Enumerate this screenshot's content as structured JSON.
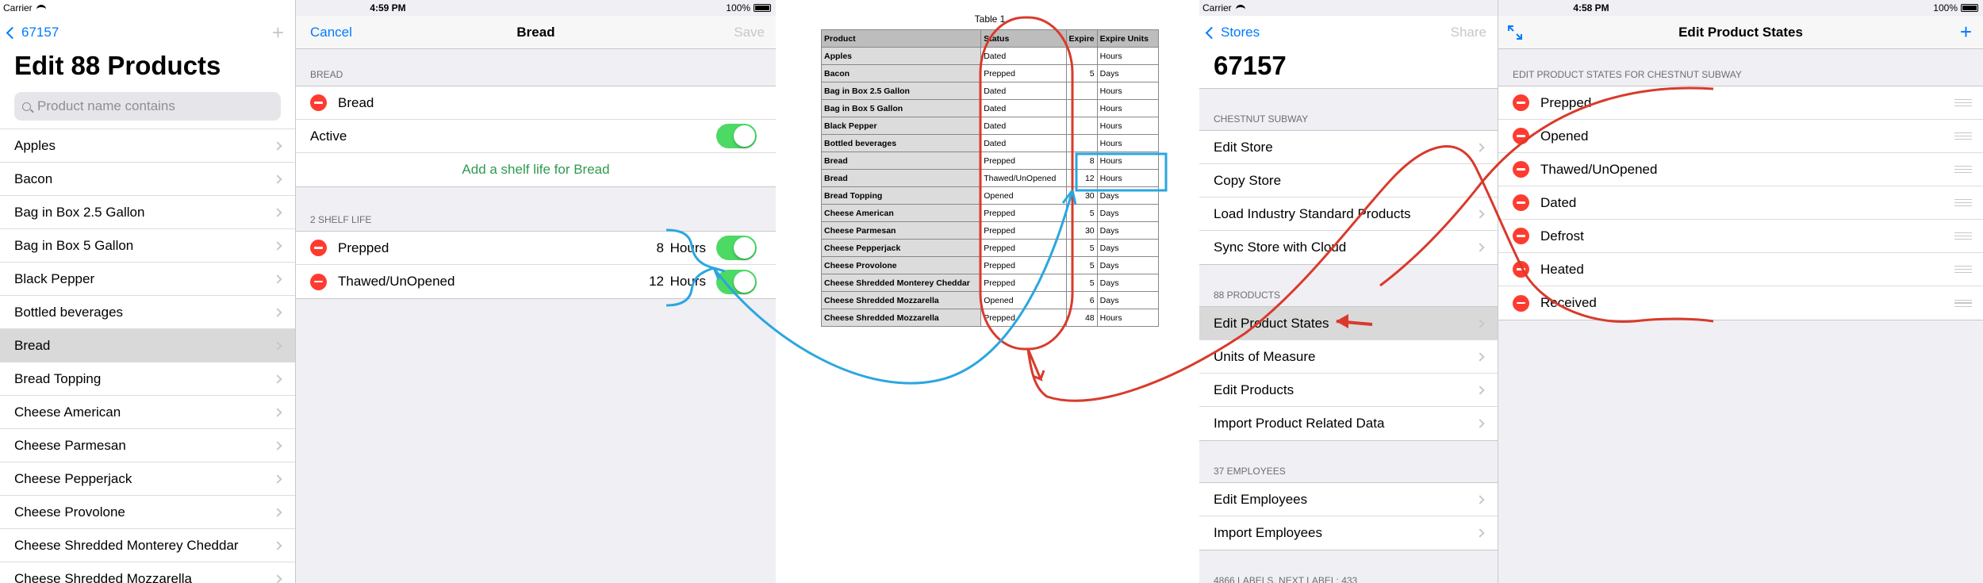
{
  "left_ipad": {
    "status": {
      "carrier": "Carrier",
      "time": "4:59 PM",
      "battery": "100%"
    },
    "master": {
      "back_label": "67157",
      "title": "Edit 88 Products",
      "search_placeholder": "Product name contains",
      "products": [
        "Apples",
        "Bacon",
        "Bag in Box 2.5 Gallon",
        "Bag in Box 5 Gallon",
        "Black Pepper",
        "Bottled beverages",
        "Bread",
        "Bread Topping",
        "Cheese American",
        "Cheese Parmesan",
        "Cheese Pepperjack",
        "Cheese Provolone",
        "Cheese Shredded Monterey Cheddar",
        "Cheese Shredded Mozzarella"
      ],
      "selected_index": 6
    },
    "detail": {
      "cancel_label": "Cancel",
      "title": "Bread",
      "save_label": "Save",
      "section_bread": "BREAD",
      "name_value": "Bread",
      "active_label": "Active",
      "add_shelf_life": "Add a shelf life for Bread",
      "section_shelf": "2 SHELF LIFE",
      "shelf_lives": [
        {
          "state": "Prepped",
          "amount": "8",
          "unit": "Hours"
        },
        {
          "state": "Thawed/UnOpened",
          "amount": "12",
          "unit": "Hours"
        }
      ]
    }
  },
  "table": {
    "caption": "Table 1",
    "headers": [
      "Product",
      "Status",
      "Expire",
      "Expire Units"
    ],
    "rows": [
      [
        "Apples",
        "Dated",
        "",
        "Hours"
      ],
      [
        "Bacon",
        "Prepped",
        "5",
        "Days"
      ],
      [
        "Bag in Box 2.5 Gallon",
        "Dated",
        "",
        "Hours"
      ],
      [
        "Bag in Box 5 Gallon",
        "Dated",
        "",
        "Hours"
      ],
      [
        "Black Pepper",
        "Dated",
        "",
        "Hours"
      ],
      [
        "Bottled beverages",
        "Dated",
        "",
        "Hours"
      ],
      [
        "Bread",
        "Prepped",
        "8",
        "Hours"
      ],
      [
        "Bread",
        "Thawed/UnOpened",
        "12",
        "Hours"
      ],
      [
        "Bread Topping",
        "Opened",
        "30",
        "Days"
      ],
      [
        "Cheese American",
        "Prepped",
        "5",
        "Days"
      ],
      [
        "Cheese Parmesan",
        "Prepped",
        "30",
        "Days"
      ],
      [
        "Cheese Pepperjack",
        "Prepped",
        "5",
        "Days"
      ],
      [
        "Cheese Provolone",
        "Prepped",
        "5",
        "Days"
      ],
      [
        "Cheese Shredded Monterey Cheddar",
        "Prepped",
        "5",
        "Days"
      ],
      [
        "Cheese Shredded Mozzarella",
        "Opened",
        "6",
        "Days"
      ],
      [
        "Cheese Shredded Mozzarella",
        "Prepped",
        "48",
        "Hours"
      ]
    ]
  },
  "right_ipad": {
    "status": {
      "carrier": "Carrier",
      "time": "4:58 PM",
      "battery": "100%"
    },
    "master": {
      "back_label": "Stores",
      "share_label": "Share",
      "title": "67157",
      "section_store": "CHESTNUT SUBWAY",
      "store_items": [
        "Edit Store",
        "Copy Store",
        "Load Industry Standard Products",
        "Sync Store with Cloud"
      ],
      "section_products": "88 PRODUCTS",
      "product_items": [
        "Edit Product States",
        "Units of Measure",
        "Edit Products",
        "Import Product Related Data"
      ],
      "section_employees": "37 EMPLOYEES",
      "employee_items": [
        "Edit Employees",
        "Import Employees"
      ],
      "section_labels": "4866 LABELS, NEXT LABEL: 433"
    },
    "detail": {
      "title": "Edit Product States",
      "section": "EDIT PRODUCT STATES FOR CHESTNUT SUBWAY",
      "states": [
        "Prepped",
        "Opened",
        "Thawed/UnOpened",
        "Dated",
        "Defrost",
        "Heated",
        "Received"
      ]
    }
  },
  "colors": {
    "ios_blue": "#007aff",
    "delete_red": "#ff3b30",
    "toggle_green": "#4cd964",
    "annotation_red": "#d93a2b",
    "annotation_blue": "#2aa6e0"
  }
}
